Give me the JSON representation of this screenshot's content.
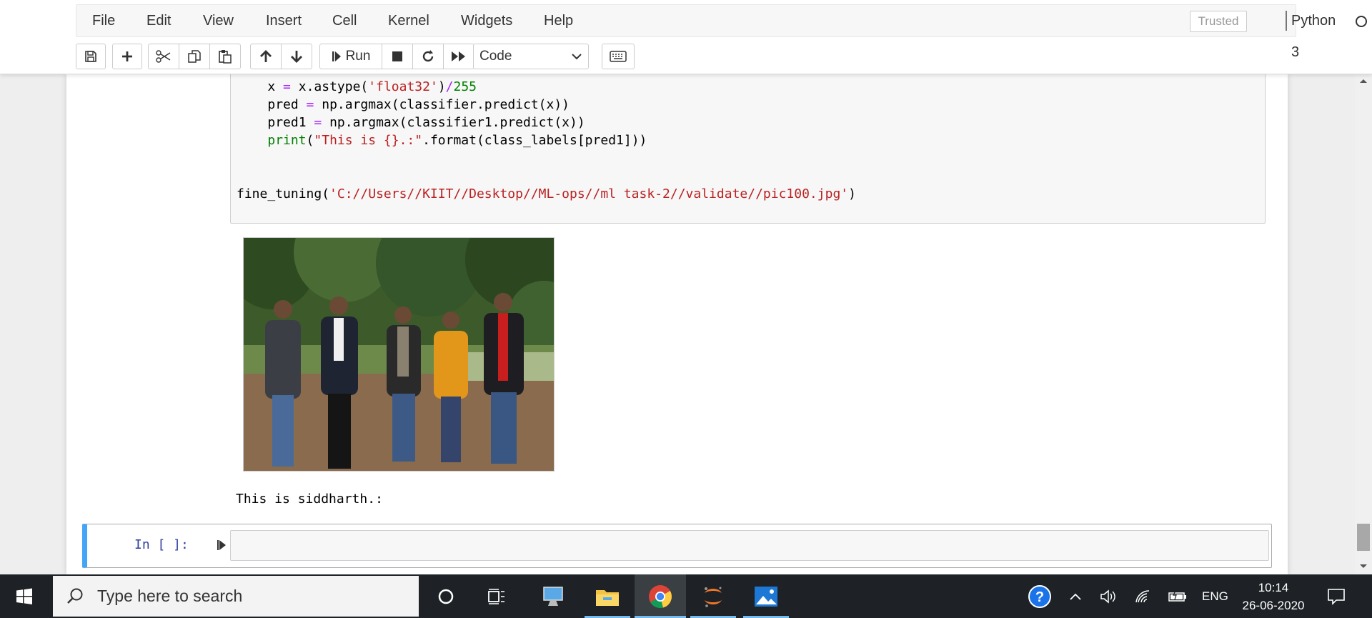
{
  "menubar": {
    "items": [
      "File",
      "Edit",
      "View",
      "Insert",
      "Cell",
      "Kernel",
      "Widgets",
      "Help"
    ],
    "trusted": "Trusted",
    "kernel": "Python 3"
  },
  "toolbar": {
    "run_label": "Run",
    "cell_type": "Code"
  },
  "code": {
    "lines": [
      {
        "indent": "    ",
        "tokens": [
          [
            "x ",
            ""
          ],
          [
            "=",
            "op"
          ],
          [
            " x.astype(",
            ""
          ],
          [
            "'float32'",
            "str"
          ],
          [
            ")",
            ""
          ],
          [
            "/",
            "op"
          ],
          [
            "255",
            "num"
          ]
        ]
      },
      {
        "indent": "    ",
        "tokens": [
          [
            "pred ",
            ""
          ],
          [
            "=",
            "op"
          ],
          [
            " np.argmax(classifier.predict(x))",
            ""
          ]
        ]
      },
      {
        "indent": "    ",
        "tokens": [
          [
            "pred1 ",
            ""
          ],
          [
            "=",
            "op"
          ],
          [
            " np.argmax(classifier1.predict(x))",
            ""
          ]
        ]
      },
      {
        "indent": "    ",
        "tokens": [
          [
            "print",
            "kw"
          ],
          [
            "(",
            ""
          ],
          [
            "\"This is {}.:\"",
            "str"
          ],
          [
            ".format(class_labels[pred1]))",
            ""
          ]
        ]
      },
      {
        "indent": "",
        "tokens": []
      },
      {
        "indent": "",
        "tokens": []
      },
      {
        "indent": "",
        "tokens": [
          [
            "fine_tuning(",
            ""
          ],
          [
            "'C://Users//KIIT//Desktop//ML-ops//ml task-2//validate//pic100.jpg'",
            "str"
          ],
          [
            ")",
            ""
          ]
        ]
      }
    ]
  },
  "output": {
    "text": "This is siddharth.:"
  },
  "new_cell": {
    "prompt": "In [ ]:"
  },
  "taskbar": {
    "search_placeholder": "Type here to search",
    "language": "ENG",
    "time": "10:14",
    "date": "26-06-2020"
  }
}
